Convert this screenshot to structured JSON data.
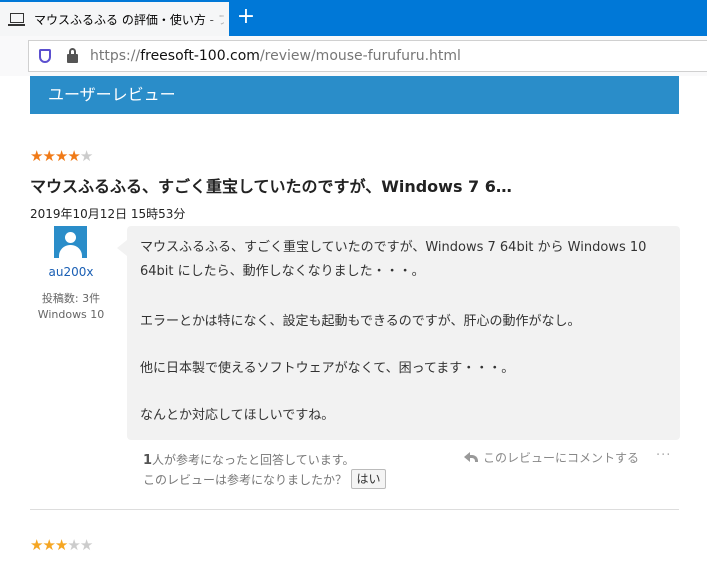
{
  "browser": {
    "tab_title": "マウスふるふる の評価・使い方 - フリ",
    "new_tab_symbol": "+",
    "url_prefix": "https://",
    "url_host": "freesoft-100.com",
    "url_path": "/review/mouse-furufuru.html"
  },
  "section": {
    "title": "ユーザーレビュー"
  },
  "review": {
    "rating": 4,
    "rating_max": 5,
    "star_on_color": "#f07a17",
    "title": "マウスふるふる、すごく重宝していたのですが、Windows 7 6…",
    "date": "2019年10月12日 15時53分",
    "user": {
      "name": "au200x",
      "post_count": "投稿数: 3件",
      "os": "Windows 10"
    },
    "paragraphs": [
      "マウスふるふる、すごく重宝していたのですが、Windows 7 64bit から Windows 10",
      "64bit にしたら、動作しなくなりました・・・。",
      "エラーとかは特になく、設定も起動もできるのですが、肝心の動作がなし。",
      "他に日本製で使えるソフトウェアがなくて、困ってます・・・。",
      "なんとか対応してほしいですね。"
    ],
    "helpful_count": "1",
    "helpful_text": "人が参考になったと回答しています。",
    "helpful_question": "このレビューは参考になりましたか？",
    "yes_label": "はい",
    "comment_label": "このレビューにコメントする",
    "more_label": "···"
  },
  "next_review": {
    "rating": 3,
    "rating_max": 5,
    "star_on_color": "#f5a623"
  }
}
